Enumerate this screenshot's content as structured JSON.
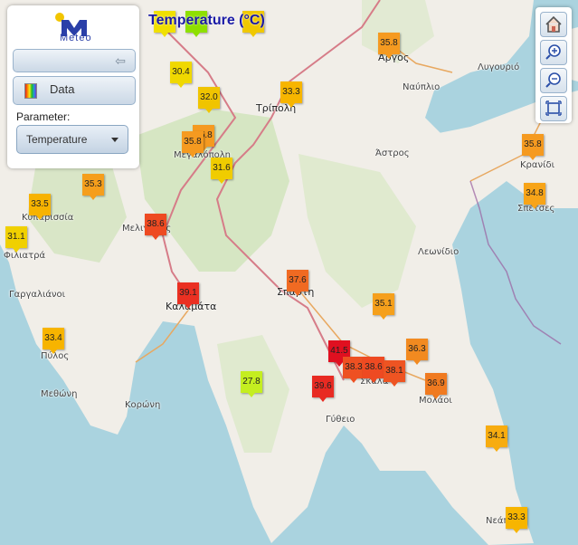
{
  "title": "Temperature (°C)",
  "panel": {
    "logo_text": "Meteo",
    "data_label": "Data",
    "parameter_label": "Parameter:",
    "parameter_value": "Temperature"
  },
  "colors": {
    "sea": "#aad3df",
    "land": "#f1eee8",
    "forest": "#cfe3b9",
    "road": "#d67c88",
    "accent": "#1a1aa6"
  },
  "places": [
    {
      "id": "argos",
      "label": "Άργος",
      "big": true
    },
    {
      "id": "tripoli",
      "label": "Τρίπολη",
      "big": true
    },
    {
      "id": "nafplio",
      "label": "Ναύπλιο"
    },
    {
      "id": "lygourio",
      "label": "Λυγουριό"
    },
    {
      "id": "megalopoli",
      "label": "Μεγαλόπολη"
    },
    {
      "id": "astros",
      "label": "Άστρος"
    },
    {
      "id": "kranidi",
      "label": "Κρανίδι"
    },
    {
      "id": "spetses",
      "label": "Σπέτσες"
    },
    {
      "id": "kyparissia",
      "label": "Κυπαρισσία"
    },
    {
      "id": "filiatra",
      "label": "Φιλιατρά"
    },
    {
      "id": "meligalas",
      "label": "Μελιγαλάς"
    },
    {
      "id": "leonidio",
      "label": "Λεωνίδιο"
    },
    {
      "id": "gargalianoi",
      "label": "Γαργαλιάνοι"
    },
    {
      "id": "sparti",
      "label": "Σπάρτη",
      "big": true
    },
    {
      "id": "kalamata",
      "label": "Καλαμάτα",
      "big": true
    },
    {
      "id": "pylos",
      "label": "Πύλος"
    },
    {
      "id": "methoni",
      "label": "Μεθώνη"
    },
    {
      "id": "koroni",
      "label": "Κορώνη"
    },
    {
      "id": "skala",
      "label": "Σκάλα"
    },
    {
      "id": "molaoi",
      "label": "Μολάοι"
    },
    {
      "id": "gytheio",
      "label": "Γύθειο"
    },
    {
      "id": "neapoli",
      "label": "Νεάπολη"
    }
  ],
  "markers": [
    {
      "v": "",
      "c": "#f0e000"
    },
    {
      "v": "",
      "c": "#8ee000"
    },
    {
      "v": "",
      "c": "#f0c800"
    },
    {
      "v": "35.8",
      "c": "#f59a20"
    },
    {
      "v": "30.4",
      "c": "#f0d800"
    },
    {
      "v": "33.3",
      "c": "#f7b500"
    },
    {
      "v": "32.0",
      "c": "#f0c400"
    },
    {
      "v": "35.8",
      "c": "#f59a20"
    },
    {
      "v": "35.8",
      "c": "#f59a20"
    },
    {
      "v": "31.6",
      "c": "#f0cc00"
    },
    {
      "v": "35.8",
      "c": "#f59a20"
    },
    {
      "v": "34.8",
      "c": "#f7a418"
    },
    {
      "v": "35.3",
      "c": "#f59e1c"
    },
    {
      "v": "33.5",
      "c": "#f7b300"
    },
    {
      "v": "31.1",
      "c": "#f0d000"
    },
    {
      "v": "38.6",
      "c": "#ee4a22"
    },
    {
      "v": "37.6",
      "c": "#f06a22"
    },
    {
      "v": "39.1",
      "c": "#ea3022"
    },
    {
      "v": "35.1",
      "c": "#f5a01c"
    },
    {
      "v": "33.4",
      "c": "#f7b400"
    },
    {
      "v": "41.5",
      "c": "#e01020"
    },
    {
      "v": "38.3",
      "c": "#ee5022"
    },
    {
      "v": "38.6",
      "c": "#ee4a22"
    },
    {
      "v": "38.1",
      "c": "#ee5422"
    },
    {
      "v": "36.3",
      "c": "#f28a20"
    },
    {
      "v": "27.8",
      "c": "#c4ee20"
    },
    {
      "v": "39.6",
      "c": "#e82a22"
    },
    {
      "v": "36.9",
      "c": "#f07a20"
    },
    {
      "v": "34.1",
      "c": "#f7ac10"
    },
    {
      "v": "33.3",
      "c": "#f7b500"
    }
  ]
}
